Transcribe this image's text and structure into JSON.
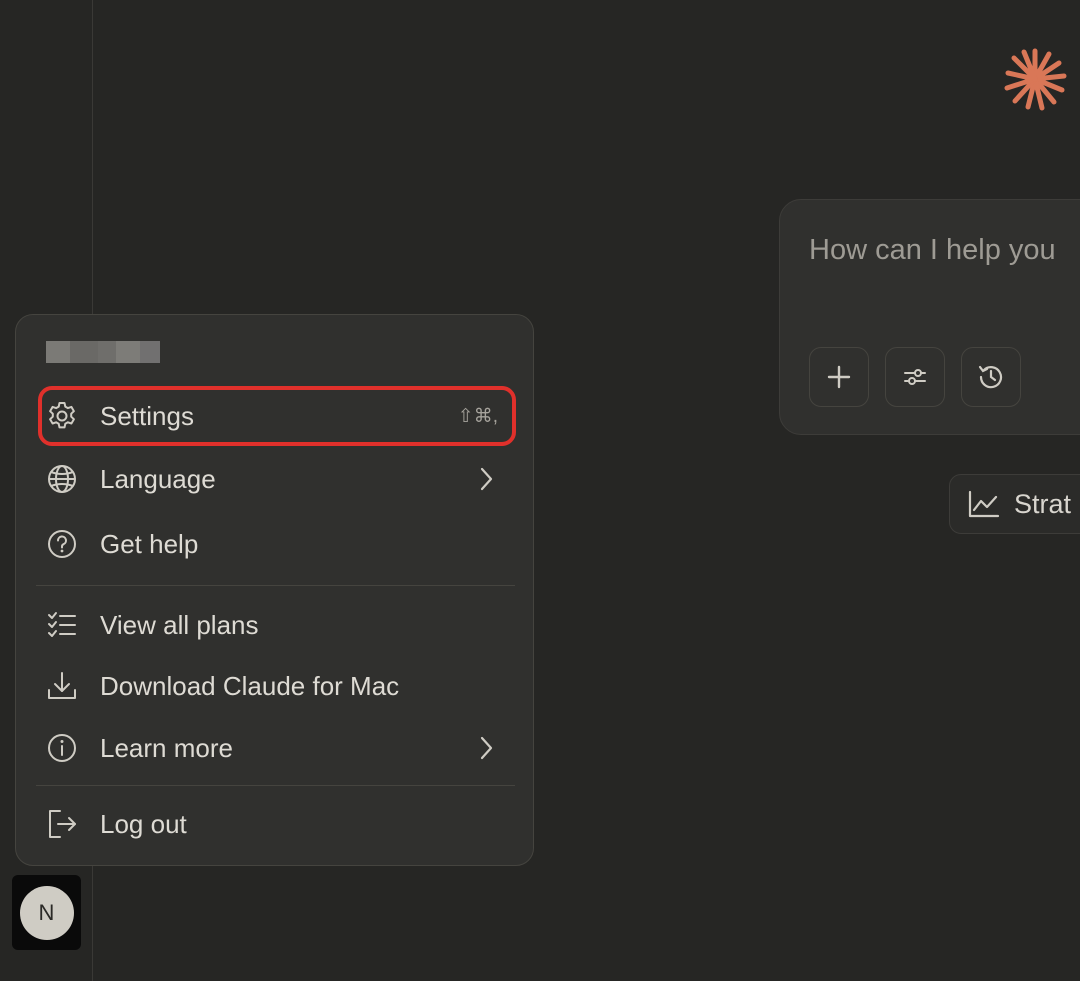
{
  "composer": {
    "placeholder": "How can I help you"
  },
  "suggestion_chip": {
    "label": "Strat",
    "icon": "chart-line-icon"
  },
  "menu": {
    "items": [
      {
        "label": "Settings",
        "icon": "gear-icon",
        "shortcut": "⇧⌘,"
      },
      {
        "label": "Language",
        "icon": "globe-icon"
      },
      {
        "label": "Get help",
        "icon": "help-circle-icon"
      },
      {
        "label": "View all plans",
        "icon": "checklist-icon"
      },
      {
        "label": "Download Claude for Mac",
        "icon": "download-icon"
      },
      {
        "label": "Learn more",
        "icon": "info-icon"
      },
      {
        "label": "Log out",
        "icon": "logout-icon"
      }
    ]
  },
  "user": {
    "avatar_initial": "N"
  },
  "colors": {
    "accent_logo": "#d97757",
    "highlight_outline": "#e0302b",
    "background": "#262624",
    "menu_background": "#30302e"
  }
}
